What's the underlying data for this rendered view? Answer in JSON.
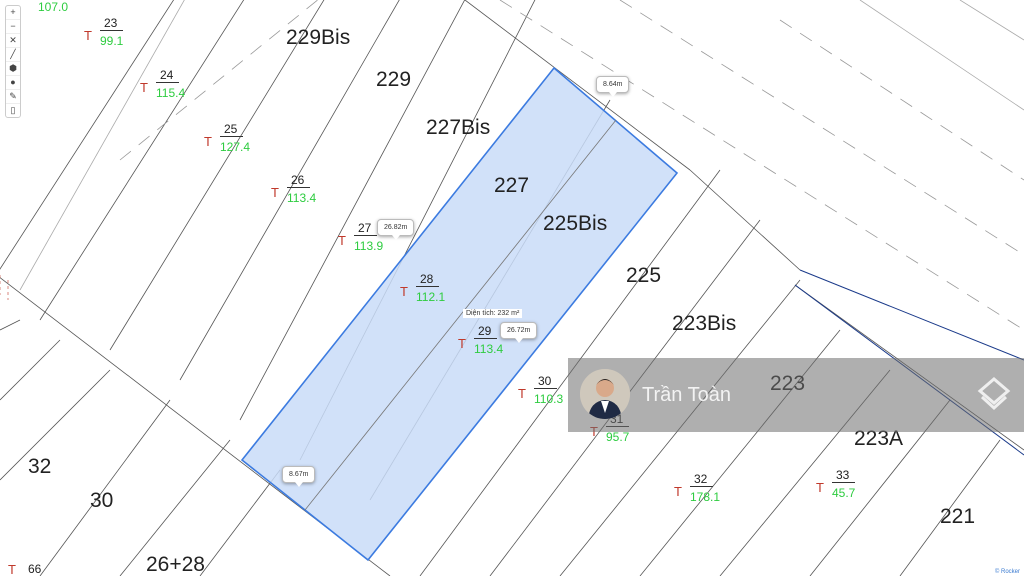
{
  "street_numbers": [
    "229Bis",
    "229",
    "227Bis",
    "227",
    "225Bis",
    "225",
    "223Bis",
    "223",
    "223A",
    "221",
    "32",
    "30",
    "26+28"
  ],
  "parcels": [
    {
      "number": "",
      "elevation": "107.0"
    },
    {
      "number": "23",
      "elevation": "99.1"
    },
    {
      "number": "24",
      "elevation": "115.4"
    },
    {
      "number": "25",
      "elevation": "127.4"
    },
    {
      "number": "26",
      "elevation": "113.4"
    },
    {
      "number": "27",
      "elevation": "113.9"
    },
    {
      "number": "28",
      "elevation": "112.1"
    },
    {
      "number": "29",
      "elevation": "113.4"
    },
    {
      "number": "30",
      "elevation": "110.3"
    },
    {
      "number": "31",
      "elevation": "95.7"
    },
    {
      "number": "32",
      "elevation": "178.1"
    },
    {
      "number": "33",
      "elevation": "45.7"
    },
    {
      "number": "66",
      "elevation": ""
    }
  ],
  "parcel_prefix": "T",
  "measurements": {
    "top_edge": "8.64m",
    "left_edge": "26.82m",
    "right_edge": "26.72m",
    "bottom_edge": "8.67m",
    "area": "Diện tích: 232 m²"
  },
  "toolbar": [
    {
      "icon": "zoom-in-icon",
      "glyph": "+"
    },
    {
      "icon": "zoom-out-icon",
      "glyph": "−"
    },
    {
      "icon": "fullscreen-icon",
      "glyph": "✕"
    },
    {
      "icon": "draw-line-icon",
      "glyph": "╱"
    },
    {
      "icon": "draw-polygon-icon",
      "glyph": "⬢"
    },
    {
      "icon": "marker-icon",
      "glyph": "●"
    },
    {
      "icon": "edit-icon",
      "glyph": "✎"
    },
    {
      "icon": "delete-icon",
      "glyph": "▯"
    }
  ],
  "watermark": {
    "name": "Trần Toàn"
  },
  "credit": "© Rocker",
  "colors": {
    "highlight_fill": "#c9dcf8",
    "highlight_stroke": "#3c7be0",
    "parcel_prefix": "#c0392b",
    "elevation": "#2ecc40"
  }
}
